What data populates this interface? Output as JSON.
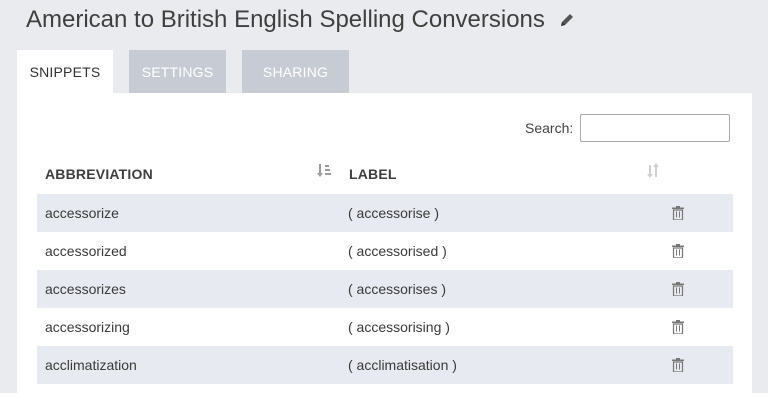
{
  "page": {
    "title": "American to British English Spelling Conversions"
  },
  "tabs": [
    {
      "label": "SNIPPETS",
      "active": true
    },
    {
      "label": "SETTINGS",
      "active": false
    },
    {
      "label": "SHARING",
      "active": false
    }
  ],
  "search": {
    "label": "Search:",
    "value": ""
  },
  "table": {
    "columns": [
      "ABBREVIATION",
      "LABEL"
    ],
    "rows": [
      {
        "abbreviation": "accessorize",
        "label": "( accessorise )"
      },
      {
        "abbreviation": "accessorized",
        "label": "( accessorised )"
      },
      {
        "abbreviation": "accessorizes",
        "label": "( accessorises )"
      },
      {
        "abbreviation": "accessorizing",
        "label": "( accessorising )"
      },
      {
        "abbreviation": "acclimatization",
        "label": "( acclimatisation )"
      }
    ]
  },
  "colors": {
    "background": "#e9ebee",
    "inactive_tab": "#c7ccd4",
    "striped_row": "#e7eaf0"
  }
}
